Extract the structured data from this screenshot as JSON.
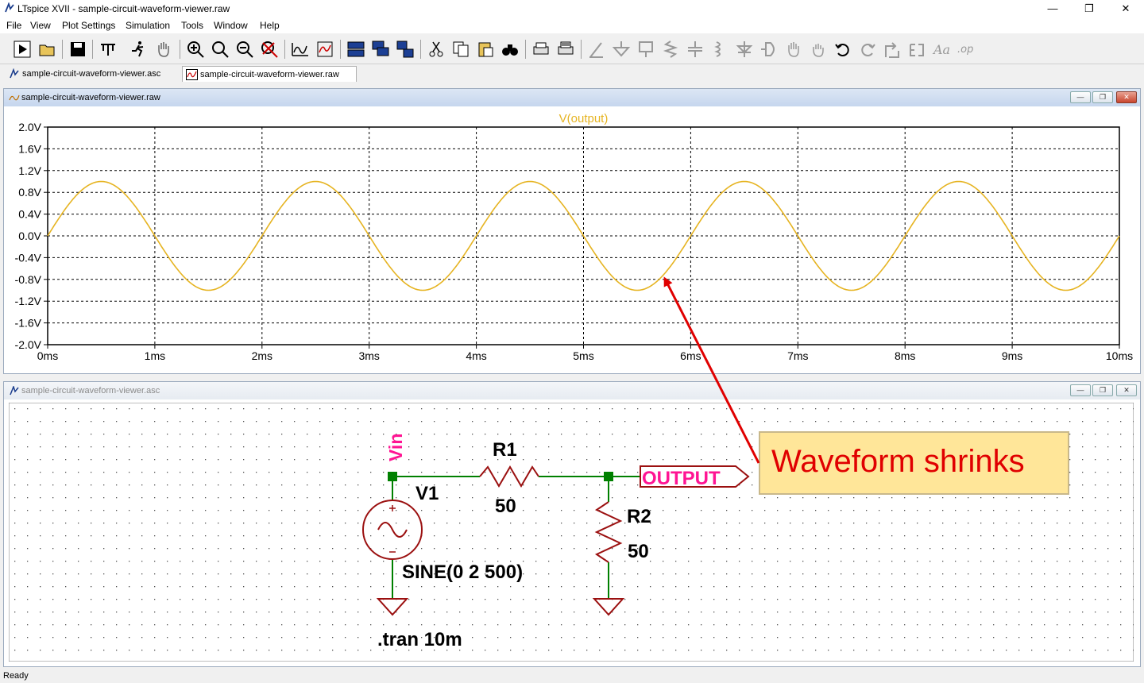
{
  "window": {
    "title": "LTspice XVII - sample-circuit-waveform-viewer.raw"
  },
  "window_controls": {
    "minimize": "—",
    "restore": "❐",
    "close": "✕"
  },
  "menu": [
    "File",
    "View",
    "Plot Settings",
    "Simulation",
    "Tools",
    "Window",
    "Help"
  ],
  "tabs": [
    {
      "label": "sample-circuit-waveform-viewer.asc",
      "icon": "schematic-icon"
    },
    {
      "label": "sample-circuit-waveform-viewer.raw",
      "icon": "waveform-icon"
    }
  ],
  "plot_window": {
    "caption": "sample-circuit-waveform-viewer.raw",
    "trace_color": "#e6b422",
    "grid": true
  },
  "schematic_window": {
    "caption": "sample-circuit-waveform-viewer.asc",
    "labels": {
      "vin": "Vin",
      "v1": "V1",
      "r1": "R1",
      "r1_value": "50",
      "r2": "R2",
      "r2_value": "50",
      "source_value": "SINE(0 2 500)",
      "output": "OUTPUT",
      "directive": ".tran 10m"
    },
    "wire_color": "#008000",
    "component_color": "#9b1010",
    "net_label_color": "#ff1493"
  },
  "callout": {
    "text": "Waveform shrinks",
    "color": "#e00000",
    "background": "#ffe699"
  },
  "status": {
    "text": "Ready"
  },
  "chart_data": {
    "type": "line",
    "title": "V(output)",
    "xlabel": "",
    "ylabel": "",
    "xlim": [
      0,
      10
    ],
    "ylim": [
      -2.0,
      2.0
    ],
    "x_ticks": [
      "0ms",
      "1ms",
      "2ms",
      "3ms",
      "4ms",
      "5ms",
      "6ms",
      "7ms",
      "8ms",
      "9ms",
      "10ms"
    ],
    "y_ticks": [
      "2.0V",
      "1.6V",
      "1.2V",
      "0.8V",
      "0.4V",
      "0.0V",
      "-0.4V",
      "-0.8V",
      "-1.2V",
      "-1.6V",
      "-2.0V"
    ],
    "series": [
      {
        "name": "V(output)",
        "function": "sine",
        "amplitude": 1.0,
        "frequency_hz": 500,
        "x_unit": "ms",
        "y_unit": "V"
      }
    ]
  }
}
